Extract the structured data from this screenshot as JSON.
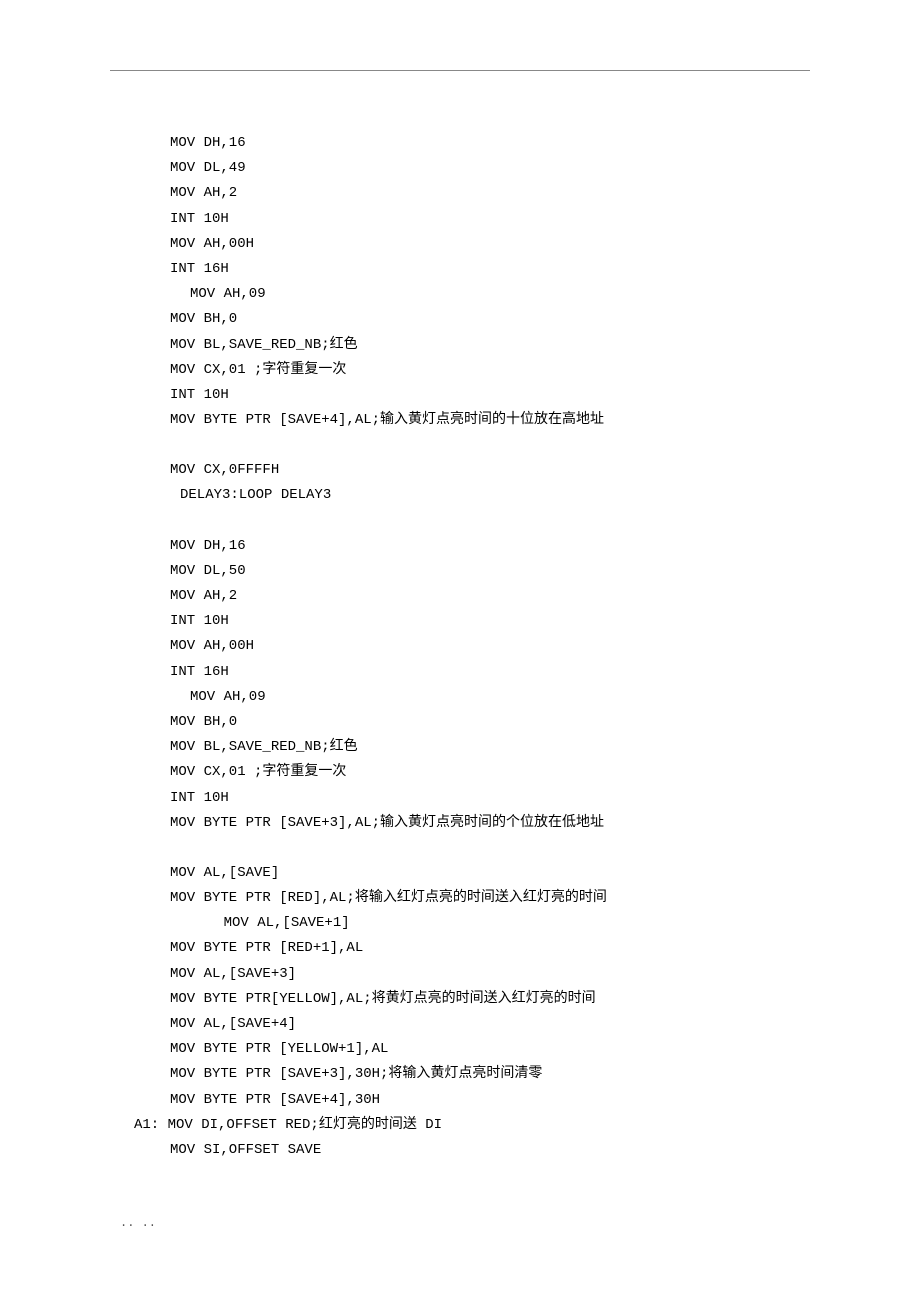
{
  "code": [
    {
      "cls": "indent1",
      "t": "MOV DH,16"
    },
    {
      "cls": "indent1",
      "t": "MOV DL,49"
    },
    {
      "cls": "indent1",
      "t": "MOV AH,2"
    },
    {
      "cls": "indent1",
      "t": "INT 10H"
    },
    {
      "cls": "indent1",
      "t": "MOV AH,00H"
    },
    {
      "cls": "indent1",
      "t": "INT 16H"
    },
    {
      "cls": "indent2",
      "t": "MOV AH,09"
    },
    {
      "cls": "indent1",
      "t": "MOV BH,0"
    },
    {
      "cls": "indent1",
      "t": "MOV BL,SAVE_RED_NB;红色"
    },
    {
      "cls": "indent1",
      "t": "MOV CX,01 ;字符重复一次"
    },
    {
      "cls": "indent1",
      "t": "INT 10H"
    },
    {
      "cls": "indent1",
      "t": "MOV BYTE PTR [SAVE+4],AL;输入黄灯点亮时间的十位放在高地址"
    },
    {
      "cls": "blank",
      "t": ""
    },
    {
      "cls": "indent1",
      "t": "MOV CX,0FFFFH"
    },
    {
      "cls": "indent3",
      "t": "DELAY3:LOOP DELAY3"
    },
    {
      "cls": "blank",
      "t": ""
    },
    {
      "cls": "indent1",
      "t": "MOV DH,16"
    },
    {
      "cls": "indent1",
      "t": "MOV DL,50"
    },
    {
      "cls": "indent1",
      "t": "MOV AH,2"
    },
    {
      "cls": "indent1",
      "t": "INT 10H"
    },
    {
      "cls": "indent1",
      "t": "MOV AH,00H"
    },
    {
      "cls": "indent1",
      "t": "INT 16H"
    },
    {
      "cls": "indent2",
      "t": "MOV AH,09"
    },
    {
      "cls": "indent1",
      "t": "MOV BH,0"
    },
    {
      "cls": "indent1",
      "t": "MOV BL,SAVE_RED_NB;红色"
    },
    {
      "cls": "indent1",
      "t": "MOV CX,01 ;字符重复一次"
    },
    {
      "cls": "indent1",
      "t": "INT 10H"
    },
    {
      "cls": "indent1",
      "t": "MOV BYTE PTR [SAVE+3],AL;输入黄灯点亮时间的个位放在低地址"
    },
    {
      "cls": "blank",
      "t": ""
    },
    {
      "cls": "indent1",
      "t": "MOV AL,[SAVE]"
    },
    {
      "cls": "indent1",
      "t": "MOV BYTE PTR [RED],AL;将输入红灯点亮的时间送入红灯亮的时间"
    },
    {
      "cls": "indent2",
      "t": "    MOV AL,[SAVE+1]"
    },
    {
      "cls": "indent1",
      "t": "MOV BYTE PTR [RED+1],AL"
    },
    {
      "cls": "indent1",
      "t": "MOV AL,[SAVE+3]"
    },
    {
      "cls": "indent1",
      "t": "MOV BYTE PTR[YELLOW],AL;将黄灯点亮的时间送入红灯亮的时间"
    },
    {
      "cls": "indent1",
      "t": "MOV AL,[SAVE+4]"
    },
    {
      "cls": "indent1",
      "t": "MOV BYTE PTR [YELLOW+1],AL"
    },
    {
      "cls": "indent1",
      "t": "MOV BYTE PTR [SAVE+3],30H;将输入黄灯点亮时间清零"
    },
    {
      "cls": "indent1",
      "t": "MOV BYTE PTR [SAVE+4],30H"
    },
    {
      "cls": "label",
      "t": "A1: MOV DI,OFFSET RED;红灯亮的时间送 DI"
    },
    {
      "cls": "indent1",
      "t": "MOV SI,OFFSET SAVE"
    }
  ],
  "footer": "..                          .."
}
